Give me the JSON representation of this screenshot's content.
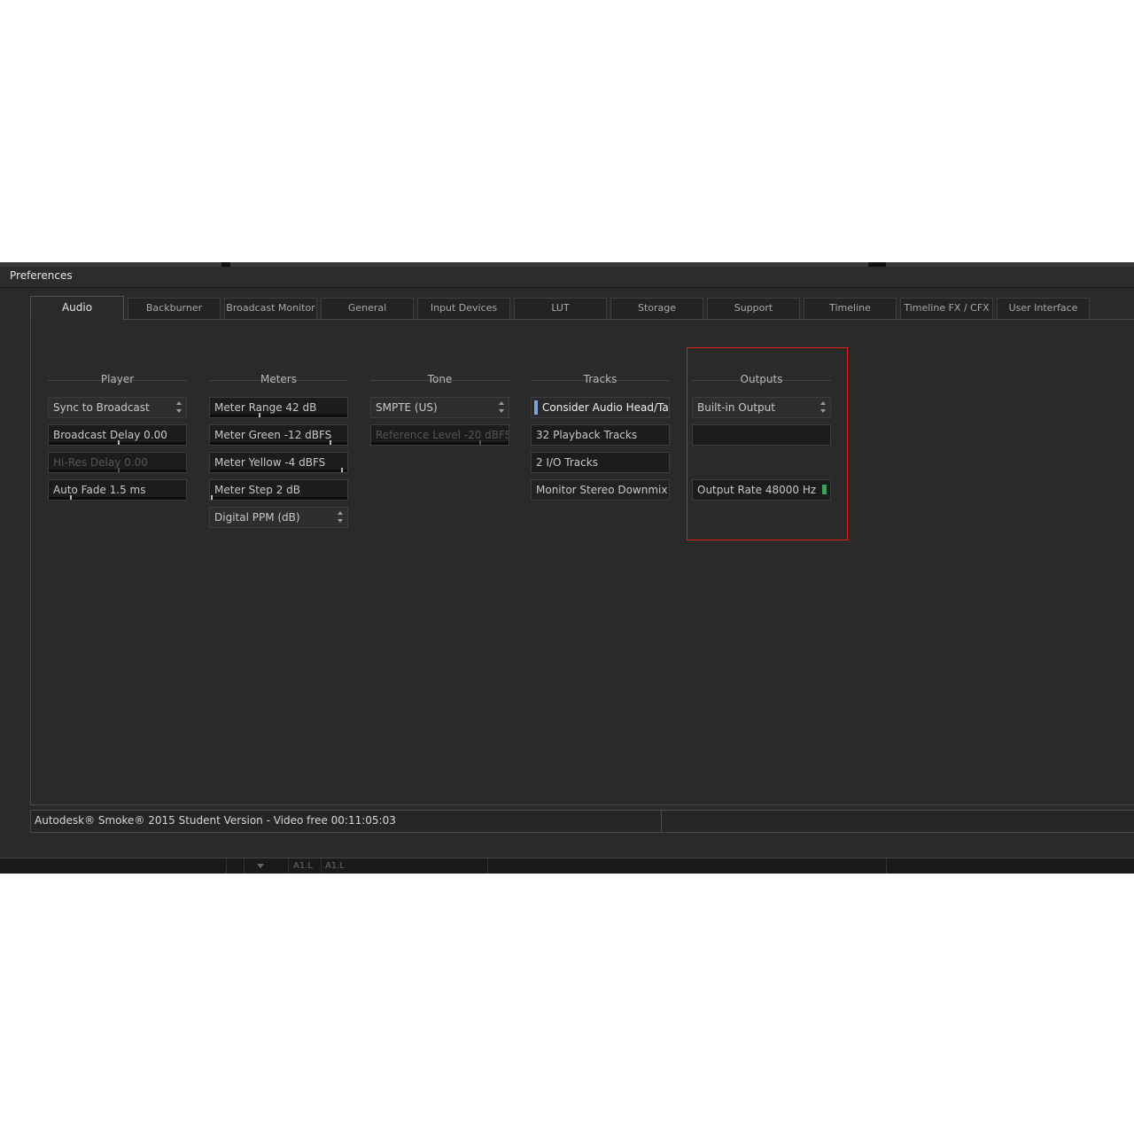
{
  "window": {
    "title": "Preferences"
  },
  "tabs": [
    {
      "label": "Audio",
      "active": true
    },
    {
      "label": "Backburner"
    },
    {
      "label": "Broadcast Monitor"
    },
    {
      "label": "General"
    },
    {
      "label": "Input Devices"
    },
    {
      "label": "LUT"
    },
    {
      "label": "Storage"
    },
    {
      "label": "Support"
    },
    {
      "label": "Timeline"
    },
    {
      "label": "Timeline FX / CFX"
    },
    {
      "label": "User Interface"
    }
  ],
  "groups": {
    "player": {
      "title": "Player",
      "sync": "Sync to Broadcast",
      "broadcast_delay": "Broadcast Delay 0.00",
      "hires_delay": "Hi-Res Delay 0.00",
      "auto_fade": "Auto Fade 1.5 ms"
    },
    "meters": {
      "title": "Meters",
      "range": "Meter Range 42 dB",
      "green": "Meter Green -12 dBFS",
      "yellow": "Meter Yellow -4 dBFS",
      "step": "Meter Step 2 dB",
      "scale": "Digital PPM (dB)"
    },
    "tone": {
      "title": "Tone",
      "standard": "SMPTE (US)",
      "reference": "Reference Level -20 dBFS"
    },
    "tracks": {
      "title": "Tracks",
      "head_tail": "Consider Audio Head/Tail",
      "playback": "32 Playback Tracks",
      "io": "2 I/O Tracks",
      "downmix": "Monitor Stereo Downmix"
    },
    "outputs": {
      "title": "Outputs",
      "device": "Built-in Output",
      "extra": "",
      "rate": "Output Rate 48000 Hz"
    }
  },
  "status": {
    "text": "Autodesk® Smoke® 2015 Student Version - Video free 00:11:05:03"
  },
  "bottom": {
    "labels": [
      "A1.L",
      "A1.L"
    ]
  },
  "colors": {
    "highlight": "#e02020",
    "lamp": "#7fa3d6",
    "led": "#3f9f5f"
  }
}
